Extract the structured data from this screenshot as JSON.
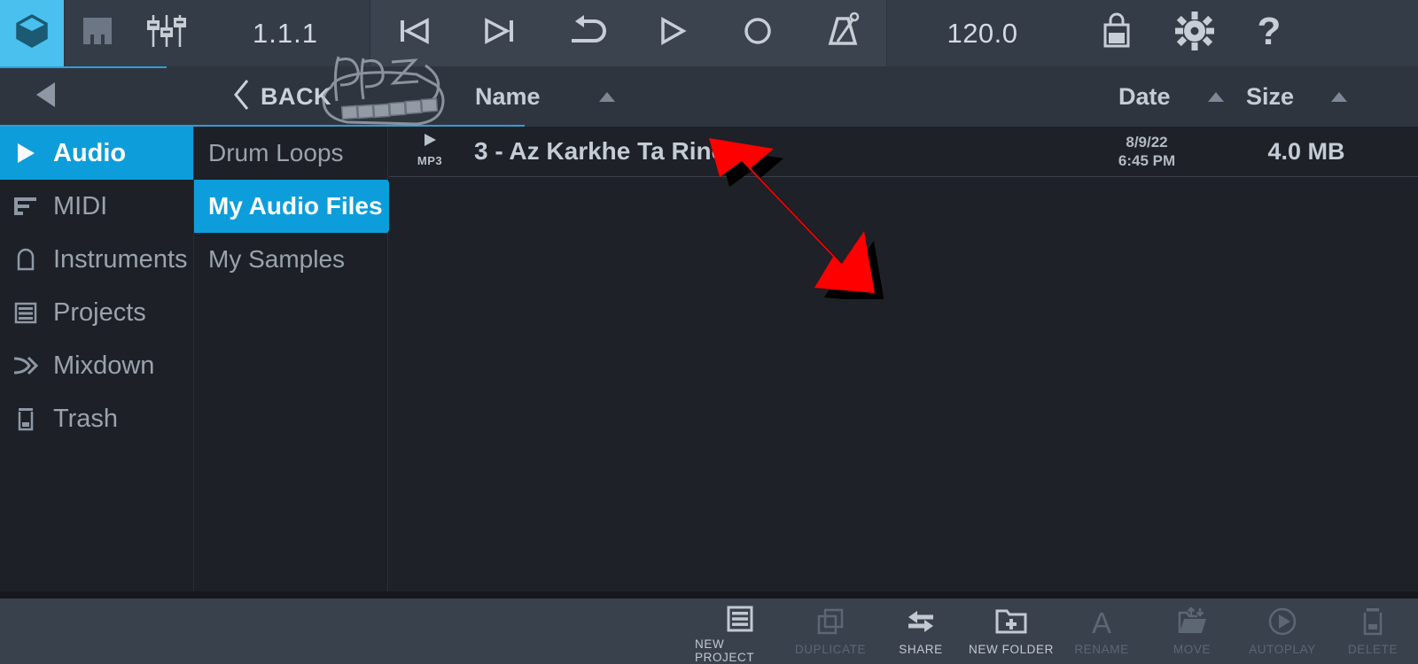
{
  "app": {
    "accent_blue": "#0d9ddb",
    "logo_tile_blue": "#4ac0ee",
    "topbar_bg": "#343c48",
    "header_bg": "#2e353f",
    "panel_bg": "#1d2026",
    "content_bg": "#1e2127",
    "bottombar_bg": "#39414d",
    "annotation_color": "#ff0000"
  },
  "topbar": {
    "logo_icon": "cube-logo-icon",
    "keyboard_icon": "piano-keys-icon",
    "mixer_icon": "mixer-faders-icon",
    "position": "1.1.1",
    "tempo": "120.0",
    "transport": [
      {
        "name": "skip-to-start-button",
        "icon": "skip-back-icon"
      },
      {
        "name": "skip-to-end-button",
        "icon": "skip-forward-icon"
      },
      {
        "name": "loop-button",
        "icon": "loop-icon"
      },
      {
        "name": "play-button",
        "icon": "play-icon"
      },
      {
        "name": "record-button",
        "icon": "record-circle-icon"
      },
      {
        "name": "metronome-button",
        "icon": "metronome-icon"
      }
    ],
    "shop_icon": "shopping-bag-icon",
    "settings_icon": "gear-icon",
    "help_icon": "question-mark-icon"
  },
  "header": {
    "nav_back_icon": "left-triangle-icon",
    "back_label": "BACK",
    "back_chevron_icon": "chevron-left-icon",
    "columns": [
      {
        "label": "Name",
        "sort_icon": "sort-ascending-triangle-icon"
      },
      {
        "label": "Date",
        "sort_icon": "sort-ascending-triangle-icon"
      },
      {
        "label": "Size",
        "sort_icon": "sort-ascending-triangle-icon"
      }
    ],
    "close_label": "✕",
    "close_icon": "close-icon"
  },
  "sidebar": {
    "items": [
      {
        "label": "Audio",
        "icon": "play-triangle-icon",
        "selected": true
      },
      {
        "label": "MIDI",
        "icon": "midi-bars-icon",
        "selected": false
      },
      {
        "label": "Instruments",
        "icon": "piano-body-icon",
        "selected": false
      },
      {
        "label": "Projects",
        "icon": "list-lines-icon",
        "selected": false
      },
      {
        "label": "Mixdown",
        "icon": "merge-arrows-icon",
        "selected": false
      },
      {
        "label": "Trash",
        "icon": "trash-can-icon",
        "selected": false
      }
    ]
  },
  "folders": {
    "items": [
      {
        "label": "Drum Loops",
        "selected": false
      },
      {
        "label": "My Audio Files",
        "selected": true
      },
      {
        "label": "My Samples",
        "selected": false
      }
    ]
  },
  "files": {
    "rows": [
      {
        "type_icon": "play-triangle-icon",
        "type_label": "MP3",
        "name": "3 - Az Karkhe Ta Rine",
        "date": "8/9/22\n6:45 PM",
        "date_line1": "8/9/22",
        "date_line2": "6:45 PM",
        "size": "4.0 MB"
      }
    ]
  },
  "bottombar": {
    "items": [
      {
        "label": "NEW PROJECT",
        "icon": "list-lines-icon",
        "enabled": true
      },
      {
        "label": "DUPLICATE",
        "icon": "copy-squares-icon",
        "enabled": false
      },
      {
        "label": "SHARE",
        "icon": "share-arrows-icon",
        "enabled": true
      },
      {
        "label": "NEW FOLDER",
        "icon": "folder-plus-icon",
        "enabled": true
      },
      {
        "label": "RENAME",
        "icon": "letter-a-icon",
        "enabled": false
      },
      {
        "label": "MOVE",
        "icon": "folder-move-icon",
        "enabled": false
      },
      {
        "label": "AUTOPLAY",
        "icon": "play-circle-icon",
        "enabled": false
      },
      {
        "label": "DELETE",
        "icon": "trash-can-icon",
        "enabled": false
      }
    ]
  },
  "annotations": {
    "arrow_icon": "red-pointer-arrow-icon",
    "watermark_icon": "handwritten-watermark-doodle"
  }
}
